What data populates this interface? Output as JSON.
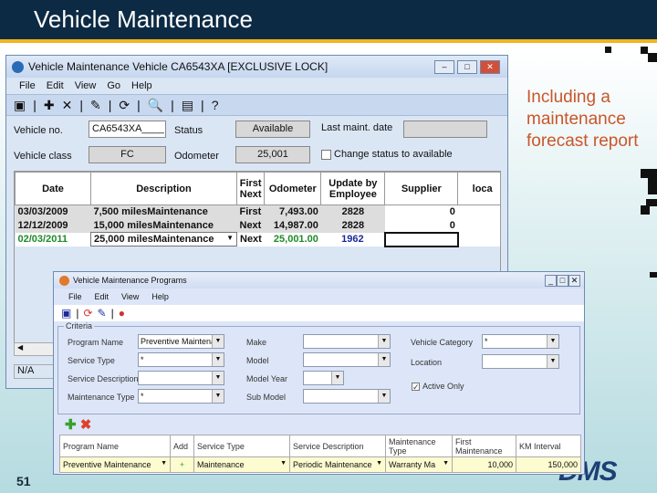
{
  "slide": {
    "title": "Vehicle Maintenance",
    "side_text": "Including a maintenance forecast report",
    "page_number": "51",
    "logo": "DMS"
  },
  "win1": {
    "title": "Vehicle Maintenance  Vehicle  CA6543XA  [EXCLUSIVE LOCK]",
    "menu": [
      "File",
      "Edit",
      "View",
      "Go",
      "Help"
    ],
    "labels": {
      "vehicle_no": "Vehicle no.",
      "status": "Status",
      "last_maint": "Last maint. date",
      "vehicle_class": "Vehicle class",
      "odometer": "Odometer",
      "change_status": "Change status to available"
    },
    "values": {
      "vehicle_no": "CA6543XA____",
      "status": "Available",
      "last_maint": "",
      "vehicle_class": "FC",
      "odometer": "25,001"
    },
    "columns": [
      "Date",
      "Description",
      "First Next",
      "Odometer",
      "Update by Employee",
      "Supplier",
      "loca"
    ],
    "rows": [
      {
        "date": "03/03/2009",
        "desc": "7,500 milesMaintenance",
        "fn": "First",
        "odo": "7,493.00",
        "emp": "2828",
        "sup": "0"
      },
      {
        "date": "12/12/2009",
        "desc": "15,000 milesMaintenance",
        "fn": "Next",
        "odo": "14,987.00",
        "emp": "2828",
        "sup": "0"
      },
      {
        "date": "02/03/2011",
        "desc": "25,000 milesMaintenance",
        "fn": "Next",
        "odo": "25,001.00",
        "emp": "1962",
        "sup": ""
      }
    ],
    "status_bar": "N/A"
  },
  "win2": {
    "title": "Vehicle Maintenance Programs",
    "menu": [
      "File",
      "Edit",
      "View",
      "Help"
    ],
    "group": "Criteria",
    "fields": [
      {
        "label": "Program Name",
        "value": "Preventive Maintenance"
      },
      {
        "label": "Service Type",
        "value": "*"
      },
      {
        "label": "Service Description",
        "value": ""
      },
      {
        "label": "Maintenance Type",
        "value": "*"
      },
      {
        "label": "Make",
        "value": ""
      },
      {
        "label": "Model",
        "value": ""
      },
      {
        "label": "Model Year",
        "value": ""
      },
      {
        "label": "Sub Model",
        "value": ""
      },
      {
        "label": "Vehicle Category",
        "value": "*"
      },
      {
        "label": "Location",
        "value": ""
      }
    ],
    "active_only": "Active Only",
    "columns": [
      "Program Name",
      "Add",
      "Service Type",
      "Service Description",
      "Maintenance Type",
      "First Maintenance",
      "KM Interval"
    ],
    "row": {
      "program": "Preventive Maintenance",
      "service_type": "Maintenance",
      "service_desc": "Periodic Maintenance",
      "maint_type": "Warranty Ma",
      "first": "10,000",
      "interval": "150,000"
    }
  }
}
